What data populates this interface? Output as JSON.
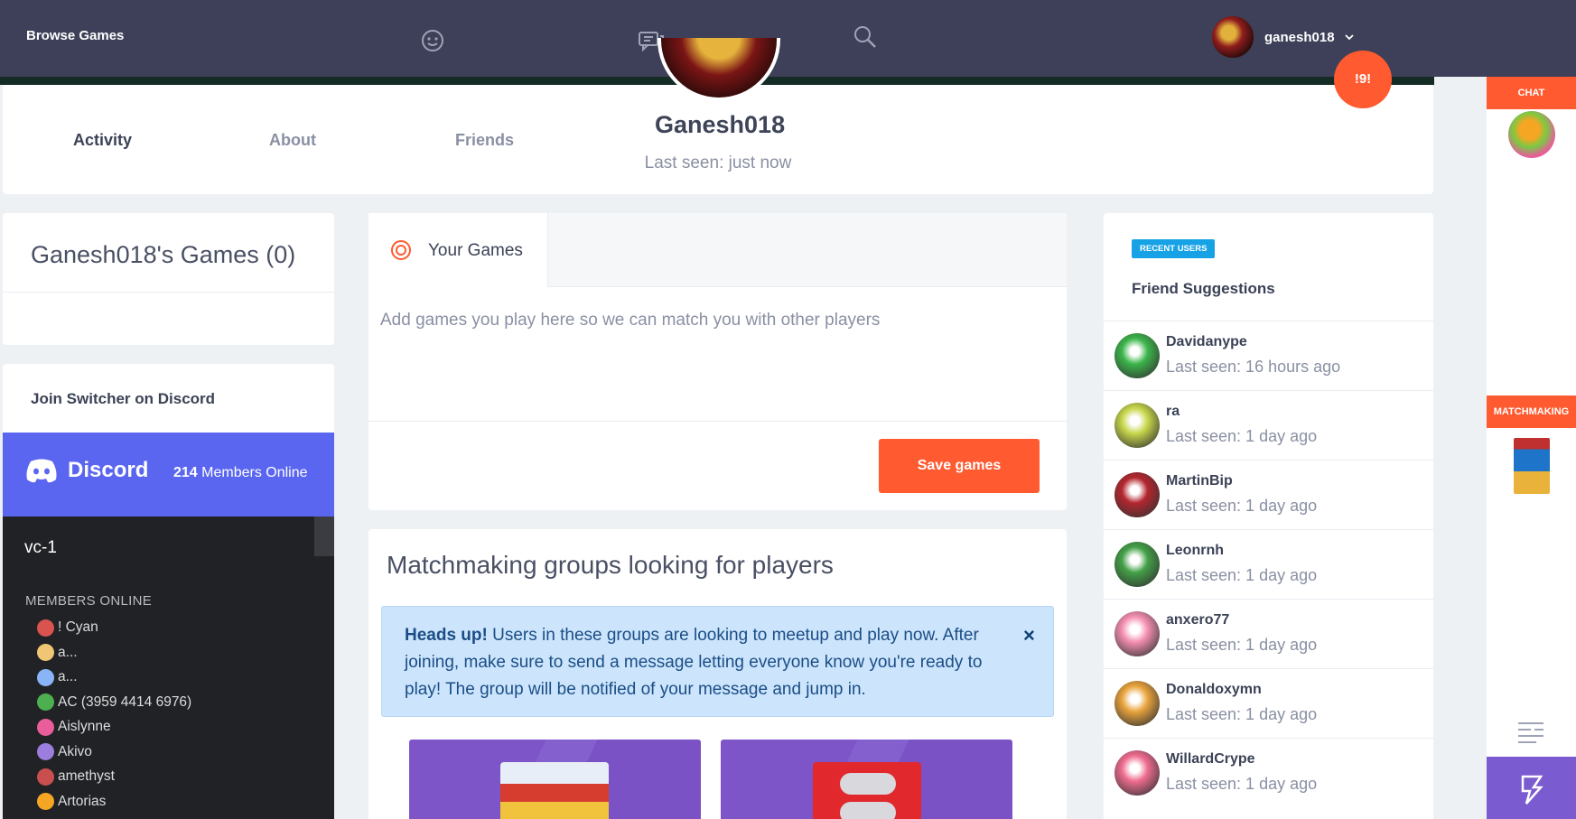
{
  "nav": {
    "brand": "Browse Games",
    "username": "ganesh018",
    "icons": [
      "smiley-icon",
      "chat-bubbles-icon",
      "search-icon",
      "chevron-down-icon"
    ]
  },
  "profile": {
    "name": "Ganesh018",
    "last_seen": "Last seen: just now",
    "tabs": [
      "Activity",
      "About",
      "Friends"
    ],
    "fab_label": "!9!"
  },
  "rail": {
    "chat_label": "CHAT",
    "matchmaking_label": "MATCHMAKING"
  },
  "games_card": {
    "title": "Ganesh018's Games (0)"
  },
  "discord": {
    "join_title": "Join Switcher on Discord",
    "brand": "Discord",
    "online_count": "214",
    "online_suffix": " Members Online",
    "channel": "vc-1",
    "members_header": "MEMBERS ONLINE",
    "members": [
      "! Cyan",
      "a...",
      "a...",
      "AC (3959 4414 6976)",
      "Aislynne",
      "Akivo",
      "amethyst",
      "Artorias"
    ],
    "member_colors": [
      "#d9534f",
      "#f0c674",
      "#8ab4f8",
      "#4caf50",
      "#e85d9a",
      "#9b7ede",
      "#c94f4f",
      "#f5a623"
    ]
  },
  "your_games": {
    "tab_label": "Your Games",
    "hint": "Add games you play here so we can match you with other players",
    "save_label": "Save games"
  },
  "matchmaking": {
    "title": "Matchmaking groups looking for players",
    "alert_bold": "Heads up!",
    "alert_text": " Users in these groups are looking to meetup and play now. After joining, make sure to send a message letting everyone know you're ready to play! The group will be notified of your message and jump in.",
    "close_glyph": "×"
  },
  "friends": {
    "badge": "RECENT USERS",
    "title": "Friend Suggestions",
    "items": [
      {
        "name": "Davidanype",
        "seen": "Last seen: 16 hours ago",
        "color": "#3bb54a"
      },
      {
        "name": "ra",
        "seen": "Last seen: 1 day ago",
        "color": "#c7d64a"
      },
      {
        "name": "MartinBip",
        "seen": "Last seen: 1 day ago",
        "color": "#b3262e"
      },
      {
        "name": "Leonrnh",
        "seen": "Last seen: 1 day ago",
        "color": "#43a047"
      },
      {
        "name": "anxero77",
        "seen": "Last seen: 1 day ago",
        "color": "#f48fb1"
      },
      {
        "name": "Donaldoxymn",
        "seen": "Last seen: 1 day ago",
        "color": "#e8a33c"
      },
      {
        "name": "WillardCrype",
        "seen": "Last seen: 1 day ago",
        "color": "#ef6c8f"
      }
    ]
  },
  "colors": {
    "accent": "#ff5a30",
    "nav_bg": "#3d4058",
    "discord_blurple": "#5a66f0",
    "badge_blue": "#17a2e6"
  }
}
